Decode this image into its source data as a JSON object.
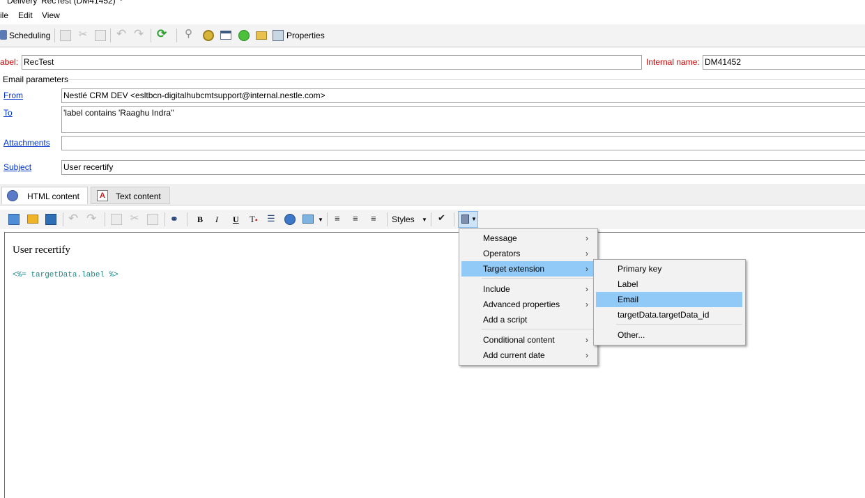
{
  "window": {
    "title": "Delivery 'RecTest (DM41452)' *"
  },
  "menubar": [
    "ile",
    "Edit",
    "View"
  ],
  "toolbar": {
    "scheduling_label": "Scheduling",
    "properties_label": "Properties"
  },
  "form": {
    "label_caption": "abel:",
    "label_value": "RecTest",
    "internal_name_caption": "Internal name:",
    "internal_name_value": "DM41452",
    "section_title": "Email parameters",
    "from_link": "From",
    "from_value": "Nestlé CRM DEV <esltbcn-digitalhubcmtsupport@internal.nestle.com>",
    "to_link": "To",
    "to_value": "'label contains 'Raaghu Indra''",
    "attachments_link": "Attachments",
    "attachments_value": "",
    "subject_link": "Subject",
    "subject_value": "User recertify"
  },
  "tabs": [
    {
      "label": "HTML content",
      "active": true
    },
    {
      "label": "Text content",
      "active": false
    }
  ],
  "editor_toolbar": {
    "bold": "B",
    "italic": "I",
    "underline": "U",
    "styles_label": "Styles"
  },
  "editor": {
    "title_text": "User recertify",
    "code_text": "<%= targetData.label %>"
  },
  "context_menu": {
    "items": [
      {
        "label": "Message",
        "submenu": true
      },
      {
        "label": "Operators",
        "submenu": true
      },
      {
        "label": "Target extension",
        "submenu": true,
        "highlighted": true
      },
      {
        "label": "Include",
        "submenu": true
      },
      {
        "label": "Advanced properties",
        "submenu": true
      },
      {
        "label": "Add a script",
        "submenu": false
      },
      {
        "label": "Conditional content",
        "submenu": true
      },
      {
        "label": "Add current date",
        "submenu": true
      }
    ]
  },
  "submenu": {
    "items": [
      {
        "label": "Primary key"
      },
      {
        "label": "Label"
      },
      {
        "label": "Email",
        "highlighted": true
      },
      {
        "label": "targetData.targetData_id"
      },
      {
        "label": "Other..."
      }
    ]
  },
  "colors": {
    "highlight": "#91c9f7",
    "label_red": "#c00000",
    "link_blue": "#0033cc",
    "code_teal": "#198a8a"
  }
}
